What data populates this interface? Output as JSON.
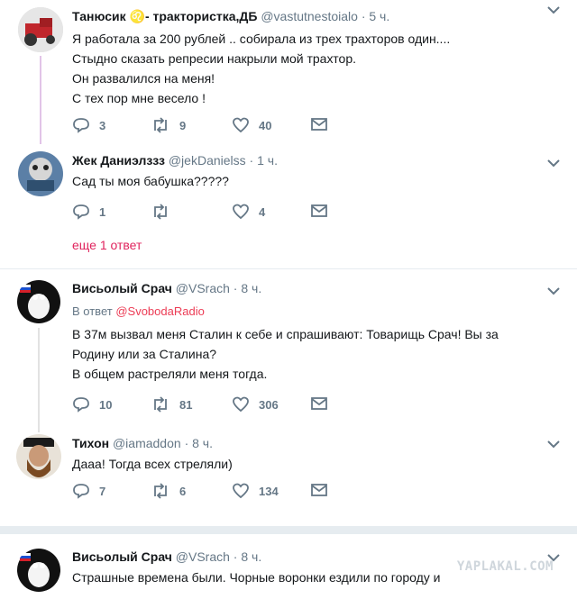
{
  "tweets": [
    {
      "name": "Танюсик ♌- трактористка,ДБ",
      "handle": "@vastutnestoialo",
      "time": "· 5 ч.",
      "lines": [
        "Я работала за 200 рублей ..  собирала из трех трахторов один....",
        "Стыдно сказать репресии накрыли мой трахтор.",
        "Он развалился на меня!",
        "С тех пор мне весело !"
      ],
      "replies": "3",
      "retweets": "9",
      "likes": "40"
    },
    {
      "name": "Жек Даниэлззз",
      "handle": "@jekDanielss",
      "time": "· 1 ч.",
      "lines": [
        "Сад ты моя бабушка?????"
      ],
      "replies": "1",
      "retweets": "",
      "likes": "4"
    },
    {
      "name": "Висьолый Срач",
      "handle": "@VSrach",
      "time": "· 8 ч.",
      "reply_prefix": "В ответ",
      "reply_mention": "@SvobodaRadio",
      "lines": [
        "В 37м вызвал меня Сталин к себе и спрашивают: Товарищь Срач! Вы за",
        "Родину или за Сталина?",
        "В общем растреляли меня тогда."
      ],
      "replies": "10",
      "retweets": "81",
      "likes": "306"
    },
    {
      "name": "Тихон",
      "handle": "@iamaddon",
      "time": "· 8 ч.",
      "lines": [
        "Дааа! Тогда всех стреляли)"
      ],
      "replies": "7",
      "retweets": "6",
      "likes": "134"
    },
    {
      "name": "Висьолый Срач",
      "handle": "@VSrach",
      "time": "· 8 ч.",
      "lines": [
        "Страшные времена были. Чорные воронки ездили по городу и"
      ]
    }
  ],
  "more_replies": "еще 1 ответ",
  "watermark": "YAPLAKAL.COM",
  "colors": {
    "thread_line": "#e2c4e8",
    "link_red": "#e0245e",
    "meta_gray": "#657786"
  }
}
